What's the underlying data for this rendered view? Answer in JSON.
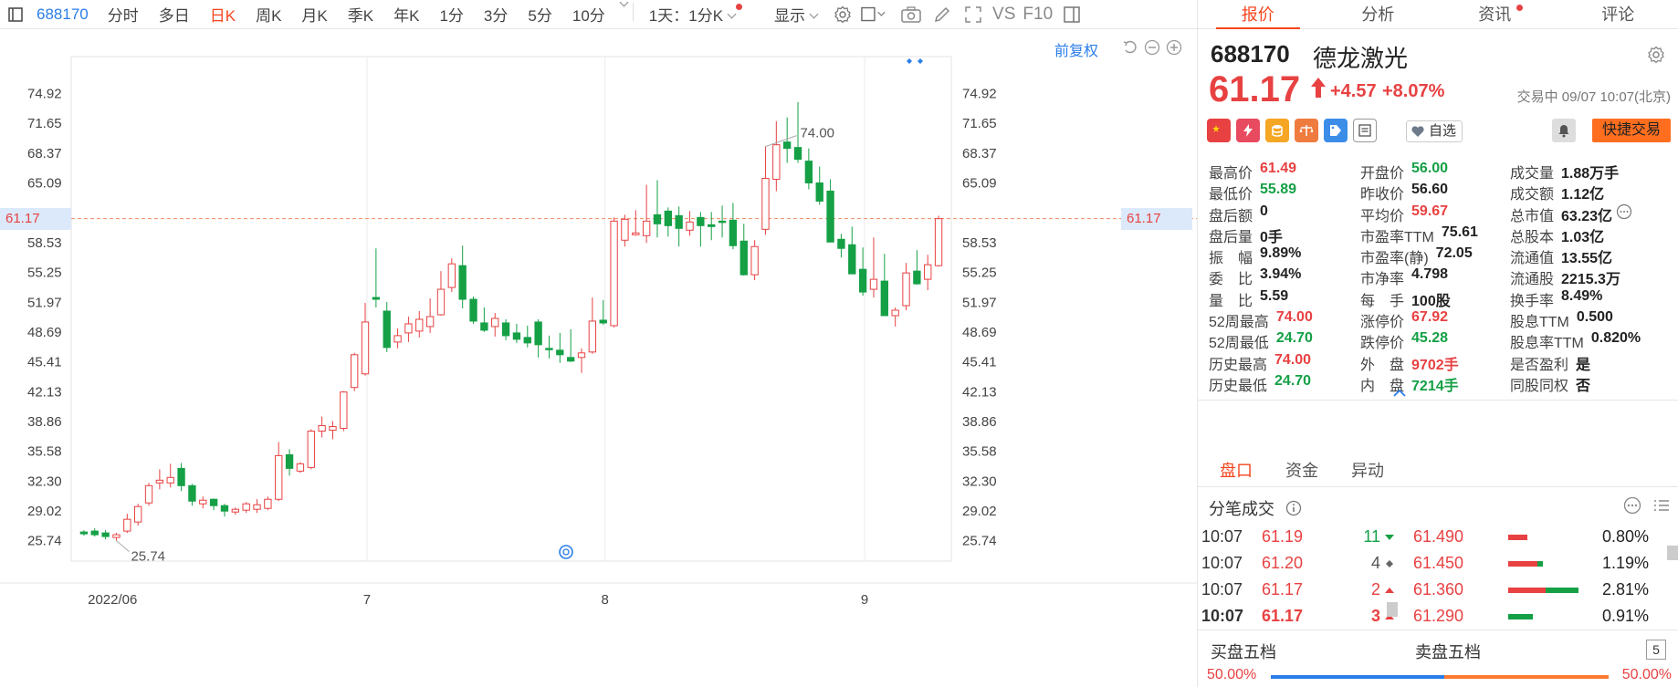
{
  "toolbar": {
    "code": "688170",
    "items": [
      "分时",
      "多日",
      "日K",
      "周K",
      "月K",
      "季K",
      "年K",
      "1分",
      "3分",
      "5分",
      "10分"
    ],
    "active_index": 2,
    "period_select": "1天：1分K",
    "display_label": "显示",
    "vs_label": "VS",
    "f10_label": "F10"
  },
  "chart": {
    "adj_label": "前复权",
    "price_tag": "61.17",
    "colors": {
      "up": "#e84142",
      "down": "#15a046",
      "grid": "#ececec",
      "dash": "#f08a5d"
    }
  },
  "chart_data": {
    "type": "candlestick",
    "title": "",
    "y_ticks": [
      "74.92",
      "71.65",
      "68.37",
      "65.09",
      "61.17",
      "58.53",
      "55.25",
      "51.97",
      "48.69",
      "45.41",
      "42.13",
      "38.86",
      "35.58",
      "32.30",
      "29.02",
      "25.74"
    ],
    "x_labels": [
      "2022/06",
      "7",
      "8",
      "9"
    ],
    "x_label_index": [
      5,
      27,
      49,
      73
    ],
    "ylim": [
      23.5,
      79.0
    ],
    "last_price": 61.17,
    "max_annot": "74.00",
    "max_index": 63,
    "min_annot": "25.74",
    "min_index": 3,
    "candles": [
      [
        26.7,
        26.9,
        26.3,
        26.5
      ],
      [
        26.8,
        27.1,
        26.2,
        26.4
      ],
      [
        26.6,
        26.9,
        25.9,
        26.2
      ],
      [
        26.1,
        26.6,
        25.74,
        26.4
      ],
      [
        26.8,
        28.7,
        26.6,
        28.1
      ],
      [
        27.8,
        29.8,
        27.4,
        29.5
      ],
      [
        29.9,
        32.1,
        29.6,
        31.8
      ],
      [
        32.1,
        33.6,
        31.4,
        32.4
      ],
      [
        32.1,
        34.2,
        31.6,
        32.7
      ],
      [
        33.7,
        34.3,
        31.2,
        31.8
      ],
      [
        31.8,
        32.0,
        29.6,
        30.1
      ],
      [
        29.8,
        30.6,
        29.3,
        30.2
      ],
      [
        30.3,
        30.4,
        29.1,
        29.6
      ],
      [
        29.6,
        29.8,
        28.4,
        29.0
      ],
      [
        28.9,
        29.4,
        28.6,
        29.2
      ],
      [
        29.1,
        30.0,
        28.8,
        29.8
      ],
      [
        29.2,
        30.3,
        28.8,
        29.7
      ],
      [
        29.3,
        30.6,
        29.1,
        30.3
      ],
      [
        30.3,
        36.6,
        30.1,
        35.1
      ],
      [
        35.2,
        35.8,
        32.9,
        33.7
      ],
      [
        33.4,
        34.4,
        33.2,
        34.2
      ],
      [
        33.8,
        38.0,
        33.6,
        37.8
      ],
      [
        37.8,
        39.4,
        37.1,
        38.4
      ],
      [
        37.9,
        38.9,
        36.9,
        38.3
      ],
      [
        38.1,
        42.2,
        37.8,
        42.1
      ],
      [
        42.6,
        46.4,
        42.2,
        46.2
      ],
      [
        44.1,
        51.9,
        43.9,
        49.8
      ],
      [
        52.5,
        57.9,
        51.4,
        52.3
      ],
      [
        51.0,
        52.0,
        46.5,
        47.0
      ],
      [
        47.6,
        49.1,
        46.9,
        48.3
      ],
      [
        48.6,
        50.4,
        47.6,
        49.6
      ],
      [
        48.8,
        51.0,
        48.1,
        50.1
      ],
      [
        49.3,
        52.4,
        48.6,
        50.4
      ],
      [
        50.6,
        55.4,
        50.5,
        53.4
      ],
      [
        53.6,
        56.8,
        53.1,
        56.2
      ],
      [
        56.0,
        58.2,
        51.3,
        52.3
      ],
      [
        52.3,
        52.6,
        49.6,
        49.9
      ],
      [
        49.7,
        51.4,
        48.7,
        48.9
      ],
      [
        49.3,
        50.8,
        48.2,
        50.2
      ],
      [
        49.7,
        50.1,
        47.8,
        48.3
      ],
      [
        48.6,
        49.6,
        47.5,
        47.9
      ],
      [
        48.1,
        49.4,
        47.0,
        47.5
      ],
      [
        49.8,
        50.1,
        45.9,
        47.3
      ],
      [
        46.9,
        48.3,
        45.8,
        46.8
      ],
      [
        46.7,
        48.6,
        45.3,
        46.2
      ],
      [
        45.9,
        49.0,
        45.4,
        45.5
      ],
      [
        45.9,
        46.9,
        44.2,
        46.4
      ],
      [
        46.5,
        52.5,
        46.3,
        49.9
      ],
      [
        50.0,
        52.2,
        49.5,
        49.7
      ],
      [
        49.4,
        61.3,
        49.2,
        60.9
      ],
      [
        58.8,
        61.6,
        58.1,
        61.1
      ],
      [
        59.4,
        62.1,
        59.3,
        59.6
      ],
      [
        59.3,
        64.9,
        58.5,
        60.9
      ],
      [
        61.6,
        65.4,
        59.1,
        60.6
      ],
      [
        62.0,
        62.4,
        59.2,
        60.4
      ],
      [
        61.5,
        62.5,
        58.1,
        60.1
      ],
      [
        59.9,
        62.0,
        59.3,
        60.8
      ],
      [
        61.3,
        61.9,
        58.1,
        60.4
      ],
      [
        60.5,
        61.9,
        58.8,
        60.3
      ],
      [
        60.9,
        62.6,
        59.1,
        60.8
      ],
      [
        61.0,
        62.9,
        57.8,
        58.2
      ],
      [
        58.7,
        60.6,
        54.9,
        55.0
      ],
      [
        55.0,
        58.8,
        54.4,
        58.1
      ],
      [
        60.0,
        69.1,
        59.4,
        65.6
      ],
      [
        65.5,
        71.9,
        64.2,
        69.3
      ],
      [
        69.6,
        72.3,
        67.3,
        68.9
      ],
      [
        69.0,
        74.0,
        67.3,
        67.7
      ],
      [
        67.5,
        68.9,
        64.4,
        65.1
      ],
      [
        65.1,
        66.9,
        62.7,
        63.1
      ],
      [
        64.2,
        65.5,
        59.9,
        58.6
      ],
      [
        58.9,
        59.5,
        56.9,
        57.9
      ],
      [
        58.3,
        60.3,
        55.1,
        55.1
      ],
      [
        55.6,
        58.0,
        52.7,
        53.1
      ],
      [
        53.4,
        59.1,
        52.5,
        54.5
      ],
      [
        54.3,
        57.3,
        50.5,
        50.5
      ],
      [
        50.5,
        51.4,
        49.3,
        51.1
      ],
      [
        51.6,
        56.3,
        51.1,
        55.2
      ],
      [
        55.4,
        57.7,
        53.9,
        54.0
      ],
      [
        54.5,
        57.2,
        53.3,
        56.1
      ],
      [
        56.0,
        61.49,
        55.89,
        61.17
      ]
    ]
  },
  "quote": {
    "tabs": [
      "报价",
      "分析",
      "资讯",
      "评论"
    ],
    "code": "688170",
    "name": "德龙激光",
    "price": "61.17",
    "change": "+4.57",
    "change_pct": "+8.07%",
    "trade_time": "交易中 09/07 10:07(北京)",
    "watch_label": "自选",
    "fast_trade": "快捷交易",
    "stats": [
      [
        {
          "l": "最高价",
          "v": "61.49",
          "c": "up"
        },
        {
          "l": "开盘价",
          "v": "56.00",
          "c": "dn"
        },
        {
          "l": "成交量",
          "v": "1.88万手",
          "c": ""
        }
      ],
      [
        {
          "l": "最低价",
          "v": "55.89",
          "c": "dn"
        },
        {
          "l": "昨收价",
          "v": "56.60",
          "c": ""
        },
        {
          "l": "成交额",
          "v": "1.12亿",
          "c": ""
        }
      ],
      [
        {
          "l": "盘后额",
          "v": "0",
          "c": ""
        },
        {
          "l": "平均价",
          "v": "59.67",
          "c": "up"
        },
        {
          "l": "总市值",
          "v": "63.23亿",
          "c": ""
        }
      ],
      [
        {
          "l": "盘后量",
          "v": "0手",
          "c": ""
        },
        {
          "l": "市盈率TTM",
          "v": "75.61",
          "c": ""
        },
        {
          "l": "总股本",
          "v": "1.03亿",
          "c": ""
        }
      ],
      [
        {
          "l": "振　幅",
          "v": "9.89%",
          "c": ""
        },
        {
          "l": "市盈率(静)",
          "v": "72.05",
          "c": ""
        },
        {
          "l": "流通值",
          "v": "13.55亿",
          "c": ""
        }
      ],
      [
        {
          "l": "委　比",
          "v": "3.94%",
          "c": ""
        },
        {
          "l": "市净率",
          "v": "4.798",
          "c": ""
        },
        {
          "l": "流通股",
          "v": "2215.3万",
          "c": ""
        }
      ],
      [
        {
          "l": "量　比",
          "v": "5.59",
          "c": ""
        },
        {
          "l": "每　手",
          "v": "100股",
          "c": ""
        },
        {
          "l": "换手率",
          "v": "8.49%",
          "c": ""
        }
      ],
      [
        {
          "l": "52周最高",
          "v": "74.00",
          "c": "up"
        },
        {
          "l": "涨停价",
          "v": "67.92",
          "c": "up"
        },
        {
          "l": "股息TTM",
          "v": "0.500",
          "c": ""
        }
      ],
      [
        {
          "l": "52周最低",
          "v": "24.70",
          "c": "dn"
        },
        {
          "l": "跌停价",
          "v": "45.28",
          "c": "dn"
        },
        {
          "l": "股息率TTM",
          "v": "0.820%",
          "c": ""
        }
      ],
      [
        {
          "l": "历史最高",
          "v": "74.00",
          "c": "up"
        },
        {
          "l": "外　盘",
          "v": "9702手",
          "c": "up"
        },
        {
          "l": "是否盈利",
          "v": "是",
          "c": ""
        }
      ],
      [
        {
          "l": "历史最低",
          "v": "24.70",
          "c": "dn"
        },
        {
          "l": "内　盘",
          "v": "7214手",
          "c": "dn"
        },
        {
          "l": "同股同权",
          "v": "否",
          "c": ""
        }
      ]
    ],
    "sub_tabs": [
      "盘口",
      "资金",
      "异动"
    ],
    "ticks_title": "分笔成交",
    "ticks": [
      {
        "time": "10:07",
        "price": "61.19",
        "vol": "11",
        "dir": "down"
      },
      {
        "time": "10:07",
        "price": "61.20",
        "vol": "4",
        "dir": "flat"
      },
      {
        "time": "10:07",
        "price": "61.17",
        "vol": "2",
        "dir": "up"
      },
      {
        "time": "10:07",
        "price": "61.17",
        "vol": "3",
        "dir": "up"
      }
    ],
    "price_dist": [
      {
        "price": "61.490",
        "pct": "0.80%",
        "r": 0.35,
        "g": 0.0
      },
      {
        "price": "61.450",
        "pct": "1.19%",
        "r": 0.55,
        "g": 0.1
      },
      {
        "price": "61.360",
        "pct": "2.81%",
        "r": 0.8,
        "g": 0.6
      },
      {
        "price": "61.290",
        "pct": "0.91%",
        "r": 0.0,
        "g": 0.45
      }
    ],
    "order_book": {
      "buy_title": "买盘五档",
      "sell_title": "卖盘五档",
      "levels": "5",
      "buy_pct": "50.00%",
      "sell_pct": "50.00%"
    }
  }
}
